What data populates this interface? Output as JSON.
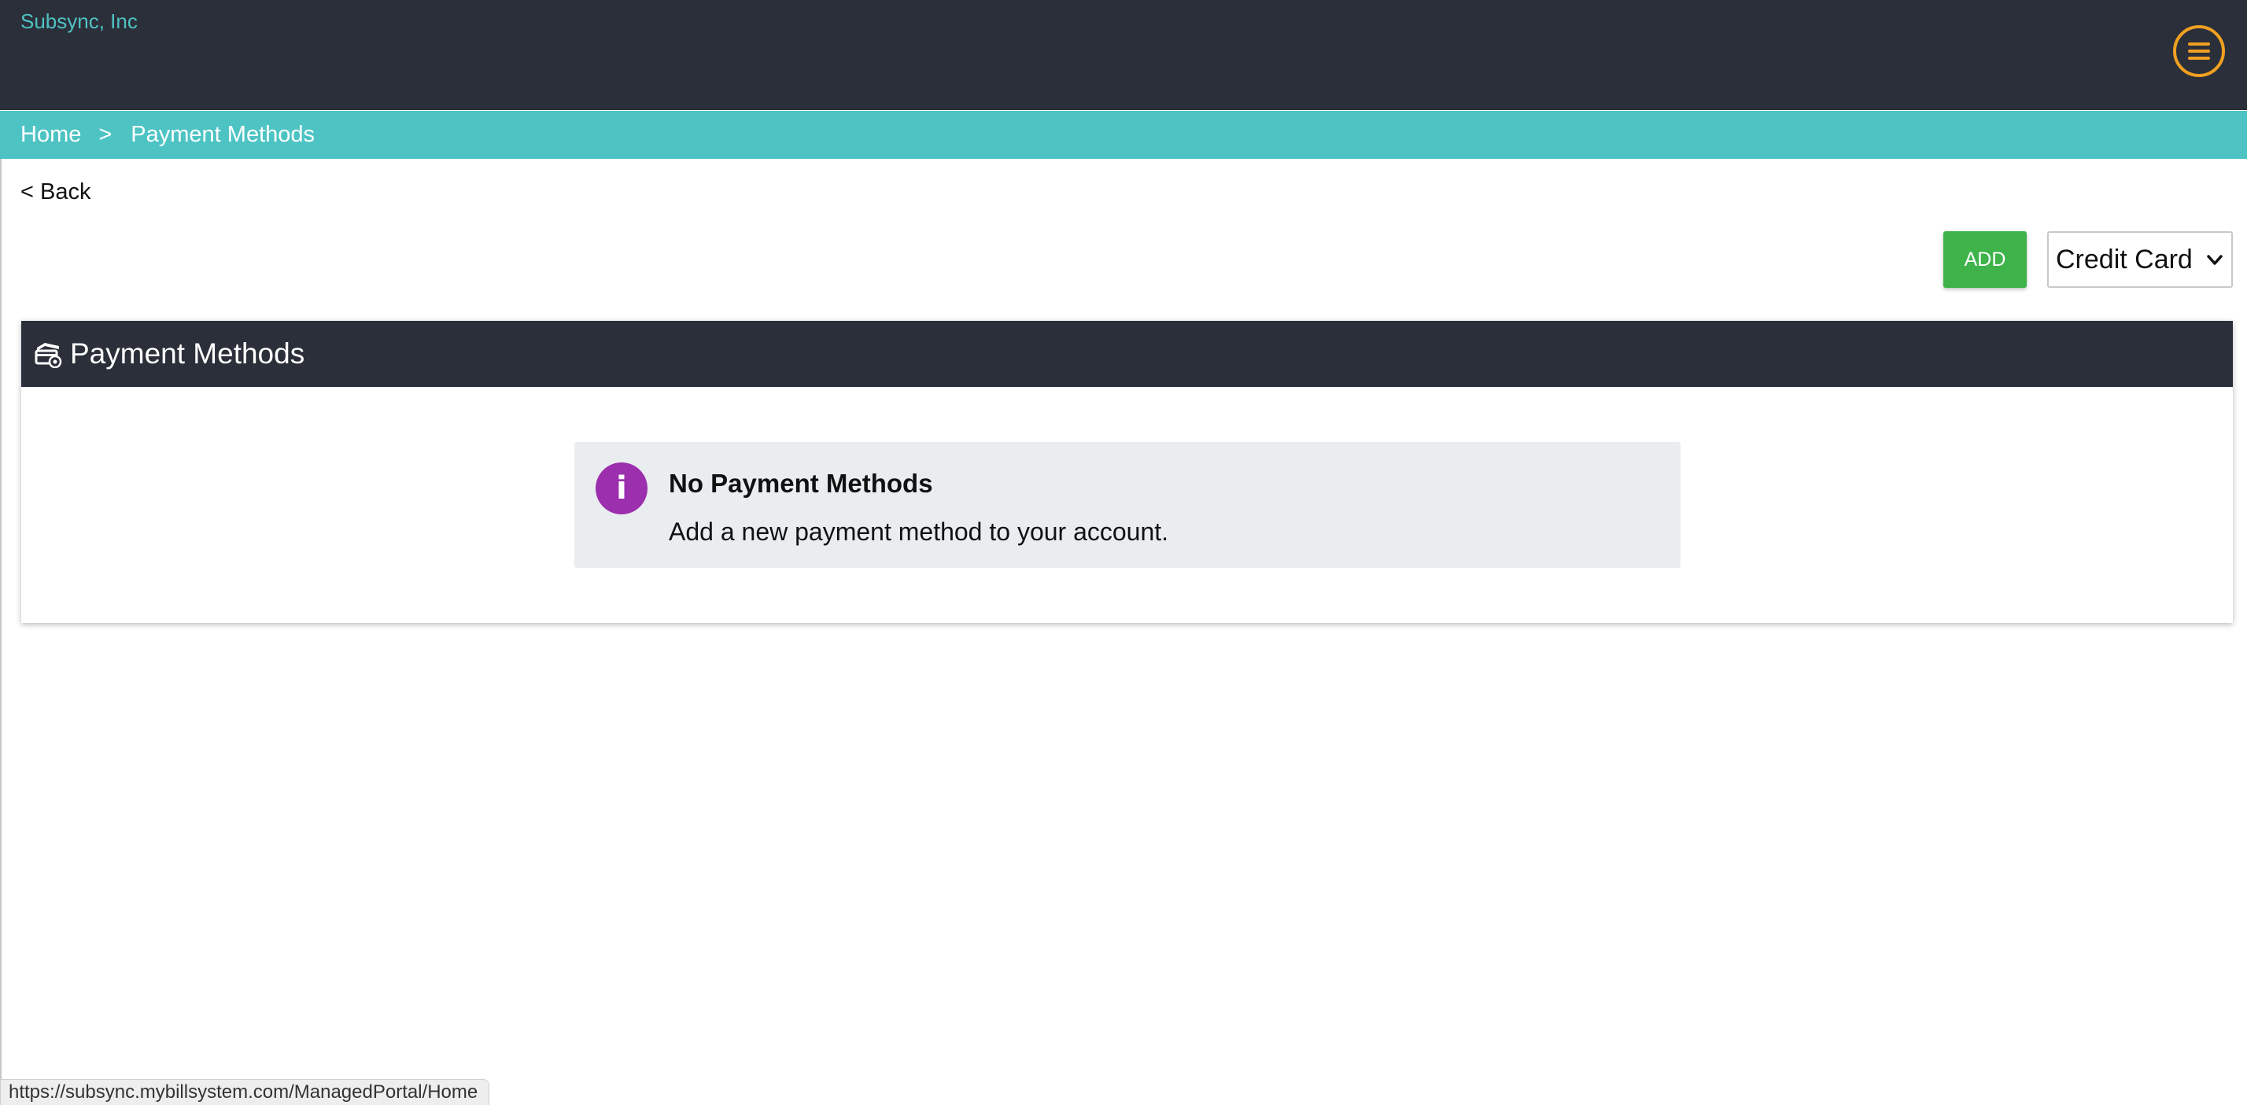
{
  "app": {
    "brand": "Subsync, Inc"
  },
  "icons": {
    "menu": "hamburger-menu-icon",
    "payment": "payment-method-icon",
    "info": "info-icon",
    "caret": "chevron-down-icon"
  },
  "colors": {
    "topbar": "#2b2f3a",
    "accent": "#4ec3c3",
    "menu_ring": "#f0a020",
    "add_button": "#3db34a",
    "info_badge": "#9b2fae"
  },
  "breadcrumb": {
    "home": "Home",
    "separator": ">",
    "current": "Payment Methods"
  },
  "nav": {
    "back": "< Back"
  },
  "toolbar": {
    "add_label": "ADD",
    "type_selected": "Credit Card"
  },
  "panel": {
    "title": "Payment Methods",
    "empty_title": "No Payment Methods",
    "empty_message": "Add a new payment method to your account.",
    "info_glyph": "i"
  },
  "statusbar": {
    "url": "https://subsync.mybillsystem.com/ManagedPortal/Home"
  }
}
